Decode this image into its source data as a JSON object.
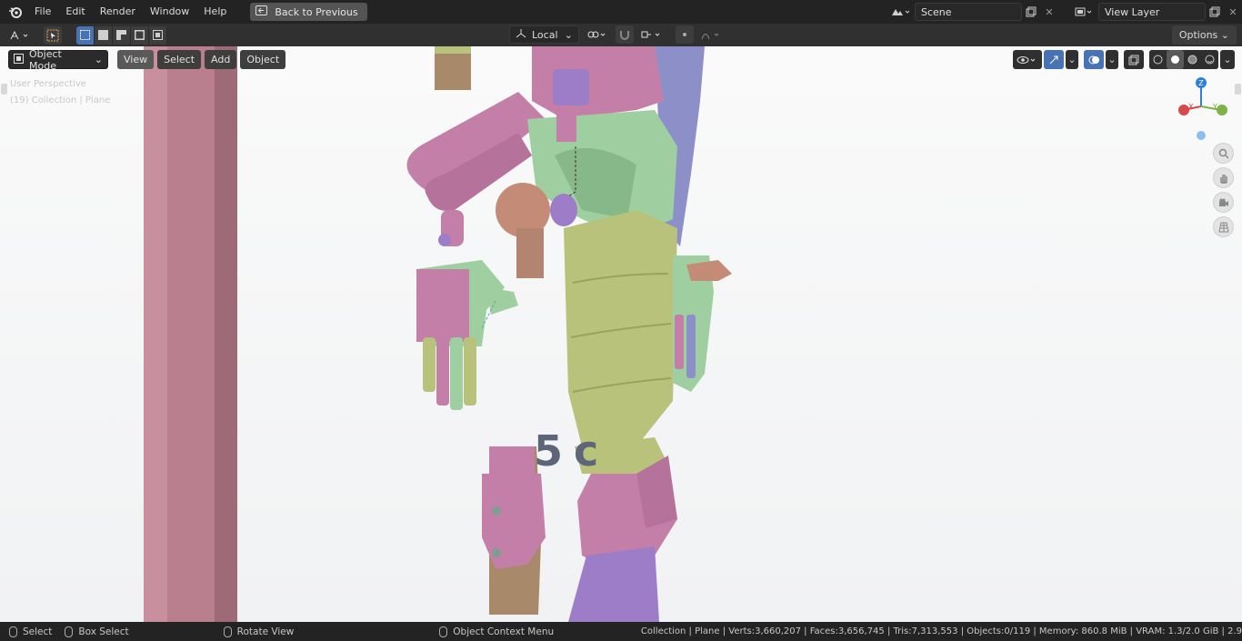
{
  "topbar": {
    "menus": [
      "File",
      "Edit",
      "Render",
      "Window",
      "Help"
    ],
    "back_label": "Back to Previous",
    "scene_name": "Scene",
    "view_layer_name": "View Layer"
  },
  "toolheader": {
    "transform_orientation": "Local",
    "options_label": "Options"
  },
  "viewport": {
    "mode_label": "Object Mode",
    "menus": [
      "View",
      "Select",
      "Add",
      "Object"
    ],
    "perspective_label": "User Perspective",
    "collection_label": "(19) Collection | Plane",
    "scene_text": "5 c",
    "gizmo": {
      "z": "Z",
      "x": "X",
      "y": "Y"
    }
  },
  "statusbar": {
    "select": "Select",
    "box_select": "Box Select",
    "rotate_view": "Rotate View",
    "context_menu": "Object Context Menu",
    "stats": "Collection | Plane | Verts:3,660,207 | Faces:3,656,745 | Tris:7,313,553 | Objects:0/119 | Memory: 860.8 MiB | VRAM: 1.3/2.0 GiB | 2.9"
  },
  "colors": {
    "accent": "#4772b3",
    "pink": "#c47fa8",
    "green": "#9fcfa0",
    "olive": "#b8c27a",
    "blue": "#8d8fc9",
    "tan": "#a8896a",
    "pillar": "#b97f8f"
  }
}
